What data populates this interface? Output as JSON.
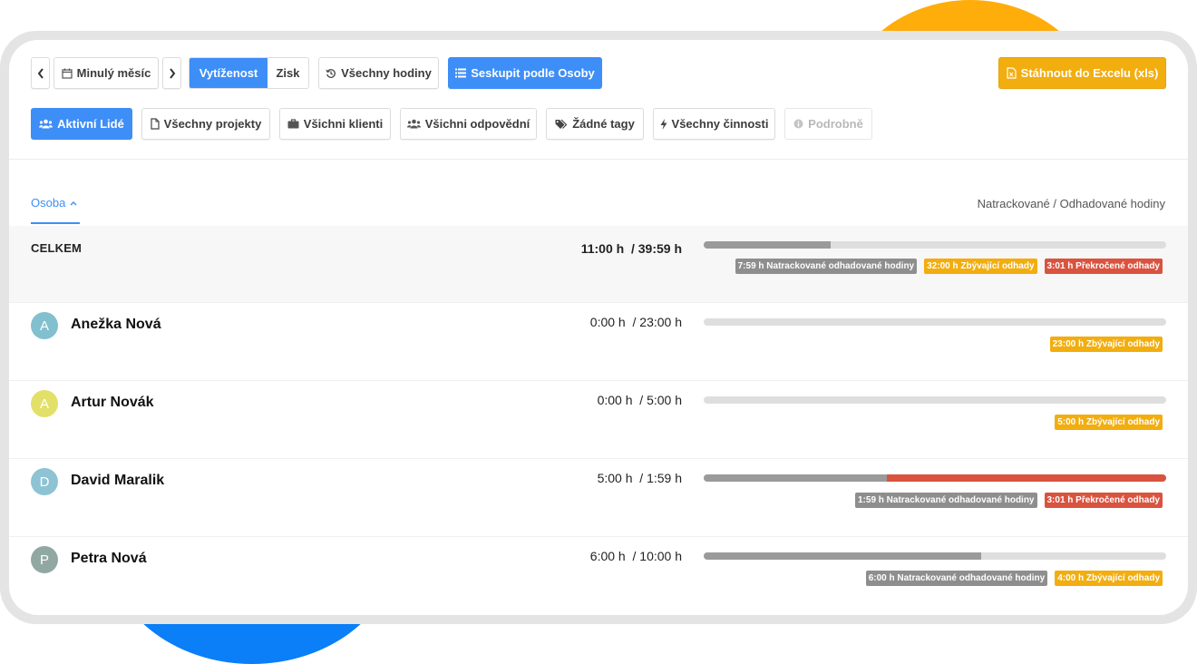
{
  "toolbar": {
    "period_label": "Minulý měsíc",
    "seg_utilization": "Vytíženost",
    "seg_profit": "Zisk",
    "all_hours": "Všechny hodiny",
    "group_by": "Seskupit podle Osoby",
    "export": "Stáhnout do Excelu (xls)"
  },
  "filters": {
    "people": "Aktivní Lidé",
    "projects": "Všechny projekty",
    "clients": "Všichni klienti",
    "responsible": "Všichni odpovědní",
    "tags": "Žádné tagy",
    "activities": "Všechny činnosti",
    "details": "Podrobně"
  },
  "table": {
    "sort_column": "Osoba",
    "right_header": "Natrackované / Odhadované hodiny"
  },
  "total": {
    "label": "CELKEM",
    "tracked": "11:00 h",
    "estimated": "/ 39:59 h",
    "progress": {
      "tracked_fraction": 0.275,
      "over_fraction": 0
    },
    "badges": [
      {
        "text": "7:59 h Natrackované odhadované hodiny",
        "kind": "gray"
      },
      {
        "text": "32:00 h Zbývající odhady",
        "kind": "amber"
      },
      {
        "text": "3:01 h Překročené odhady",
        "kind": "red"
      }
    ]
  },
  "people": [
    {
      "initial": "A",
      "name": "Anežka Nová",
      "avatar_color": "#82bfcf",
      "tracked": "0:00 h",
      "estimated": "/ 23:00 h",
      "progress": {
        "tracked_fraction": 0,
        "over_fraction": 0
      },
      "badges": [
        {
          "text": "23:00 h Zbývající odhady",
          "kind": "amber"
        }
      ]
    },
    {
      "initial": "A",
      "name": "Artur Novák",
      "avatar_color": "#e3e06a",
      "tracked": "0:00 h",
      "estimated": "/ 5:00 h",
      "progress": {
        "tracked_fraction": 0,
        "over_fraction": 0
      },
      "badges": [
        {
          "text": "5:00 h Zbývající odhady",
          "kind": "amber"
        }
      ]
    },
    {
      "initial": "D",
      "name": "David Maralik",
      "avatar_color": "#8ec3d3",
      "tracked": "5:00 h",
      "estimated": "/ 1:59 h",
      "progress": {
        "tracked_fraction": 0.397,
        "over_fraction": 0.603
      },
      "badges": [
        {
          "text": "1:59 h Natrackované odhadované hodiny",
          "kind": "gray"
        },
        {
          "text": "3:01 h Překročené odhady",
          "kind": "red"
        }
      ]
    },
    {
      "initial": "P",
      "name": "Petra Nová",
      "avatar_color": "#91a8a2",
      "tracked": "6:00 h",
      "estimated": "/ 10:00 h",
      "progress": {
        "tracked_fraction": 0.6,
        "over_fraction": 0
      },
      "badges": [
        {
          "text": "6:00 h Natrackované odhadované hodiny",
          "kind": "gray"
        },
        {
          "text": "4:00 h Zbývající odhady",
          "kind": "amber"
        }
      ]
    }
  ]
}
